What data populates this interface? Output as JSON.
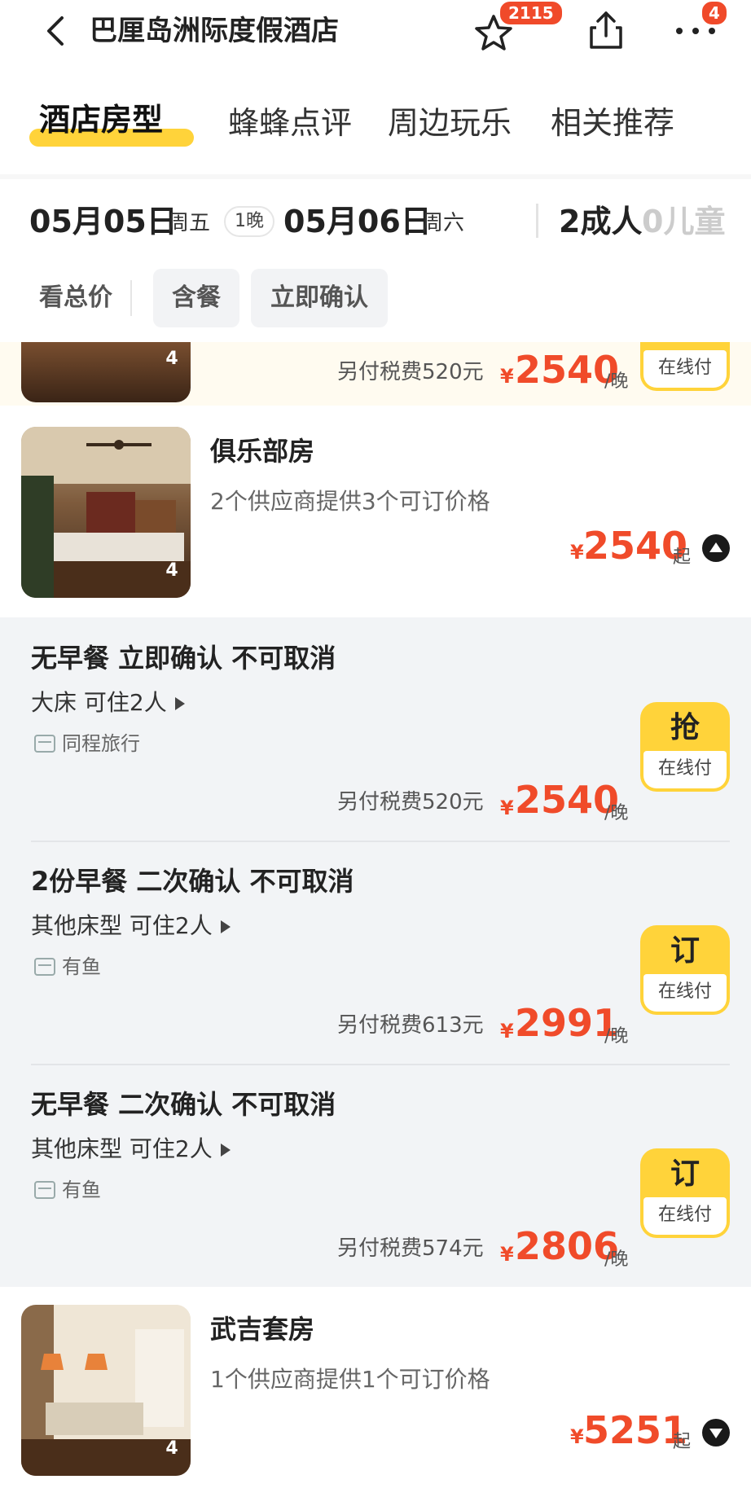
{
  "header": {
    "title": "巴厘岛洲际度假酒店",
    "favorites_count": "2115",
    "more_badge": "4"
  },
  "tabs": [
    {
      "label": "酒店房型",
      "active": true
    },
    {
      "label": "蜂蜂点评"
    },
    {
      "label": "周边玩乐"
    },
    {
      "label": "相关推荐"
    }
  ],
  "dates": {
    "checkin": "05月05日",
    "checkin_dow": "周五",
    "nights": "1晚",
    "checkout": "05月06日",
    "checkout_dow": "周六",
    "adults": "2成人",
    "children": "0儿童"
  },
  "filters": [
    "看总价",
    "含餐",
    "立即确认"
  ],
  "partial_row": {
    "thumb_count": "4",
    "tax": "另付税费520元",
    "currency": "¥",
    "price": "2540",
    "per_night": "/晚",
    "pay_label": "在线付"
  },
  "rooms": [
    {
      "name": "俱乐部房",
      "suppliers": "2个供应商提供3个可订价格",
      "thumb_count": "4",
      "currency": "¥",
      "price": "2540",
      "price_suffix": "起",
      "expanded": true,
      "offers": [
        {
          "title": "无早餐  立即确认  不可取消",
          "bed": "大床  可住2人",
          "vendor": "同程旅行",
          "tax": "另付税费520元",
          "currency": "¥",
          "price": "2540",
          "per_night": "/晚",
          "button": "抢",
          "pay": "在线付"
        },
        {
          "title": "2份早餐  二次确认  不可取消",
          "bed": "其他床型  可住2人",
          "vendor": "有鱼",
          "tax": "另付税费613元",
          "currency": "¥",
          "price": "2991",
          "per_night": "/晚",
          "button": "订",
          "pay": "在线付"
        },
        {
          "title": "无早餐  二次确认  不可取消",
          "bed": "其他床型  可住2人",
          "vendor": "有鱼",
          "tax": "另付税费574元",
          "currency": "¥",
          "price": "2806",
          "per_night": "/晚",
          "button": "订",
          "pay": "在线付"
        }
      ]
    },
    {
      "name": "武吉套房",
      "suppliers": "1个供应商提供1个可订价格",
      "thumb_count": "4",
      "currency": "¥",
      "price": "5251",
      "price_suffix": "起",
      "expanded": false
    }
  ],
  "colors": {
    "accent_yellow": "#ffd33a",
    "price_red": "#f04b2a",
    "badge_red": "#f04a2a"
  }
}
